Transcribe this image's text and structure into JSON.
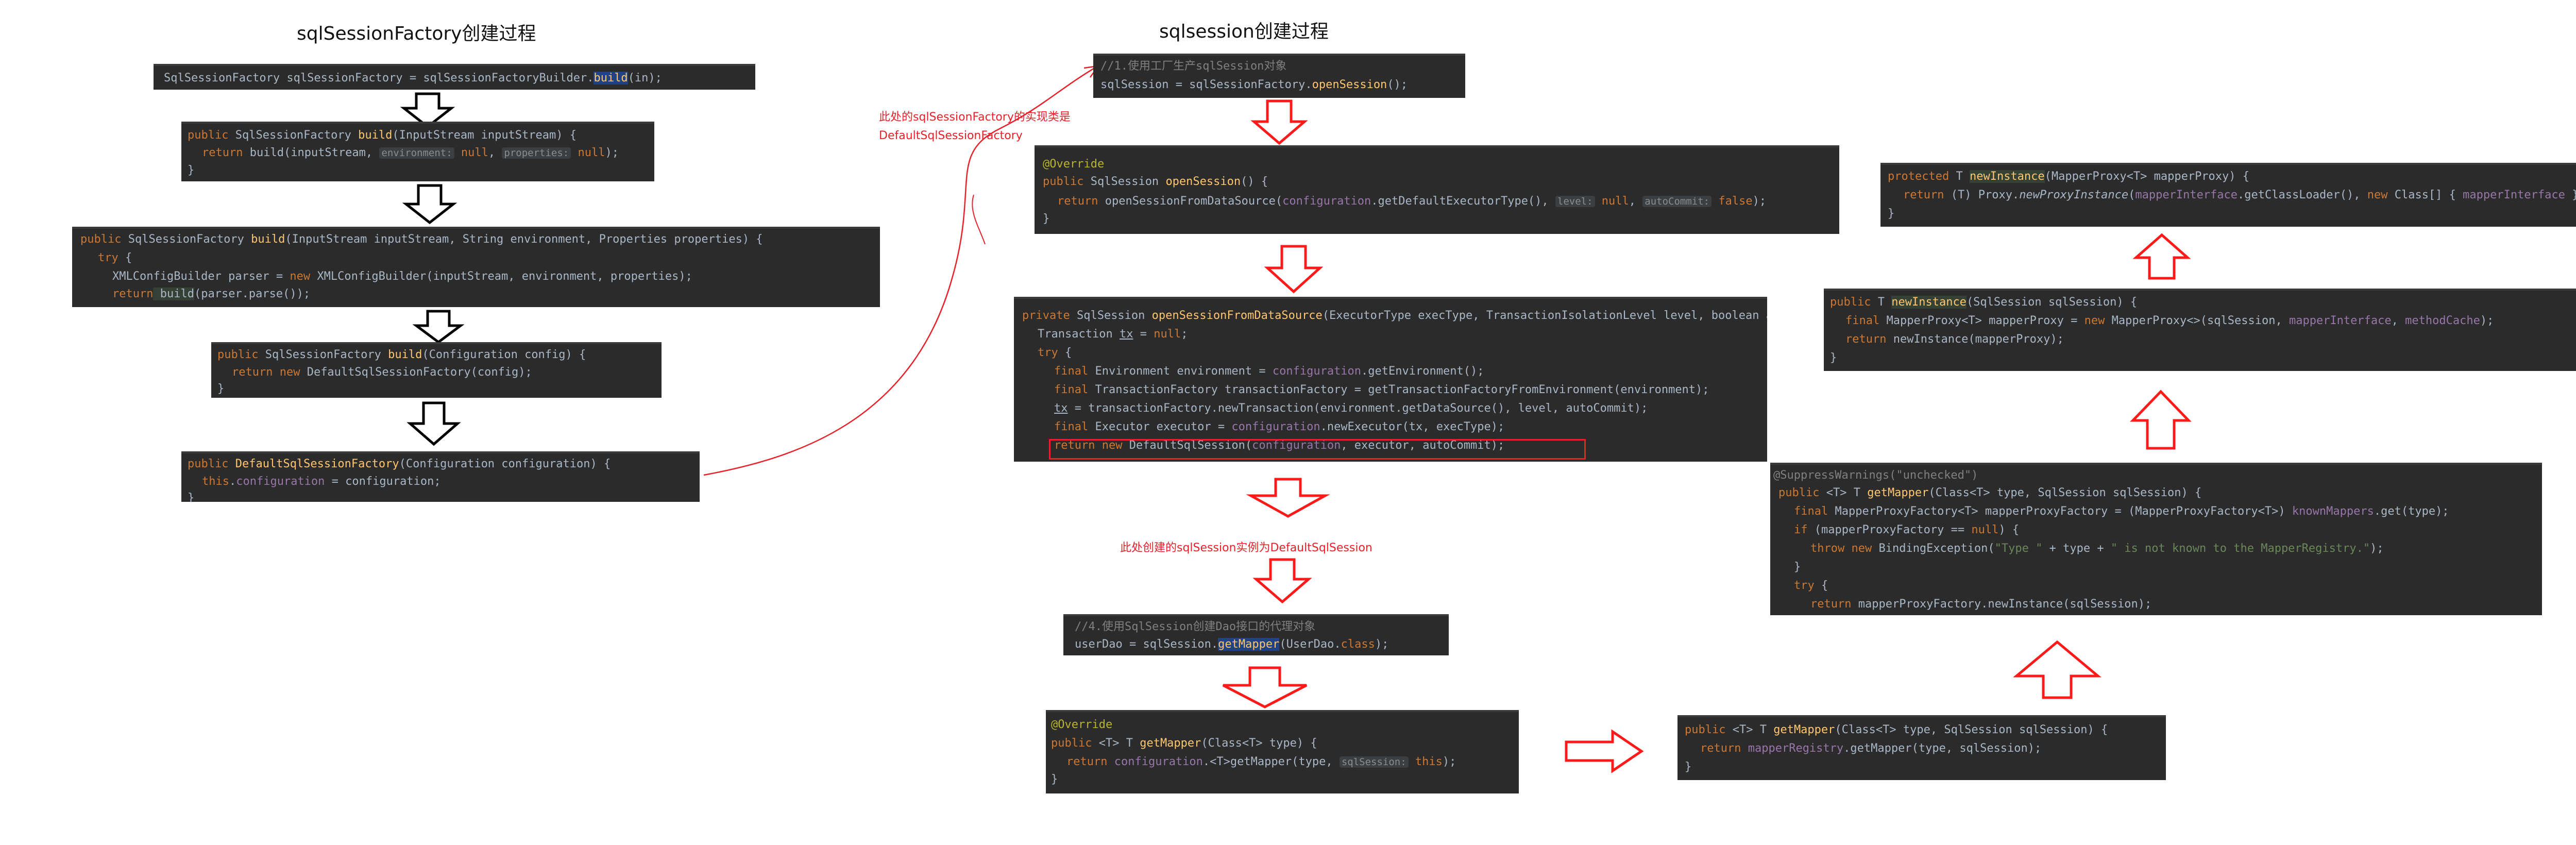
{
  "titles": {
    "factory": "sqlSessionFactory创建过程",
    "session": "sqlsession创建过程"
  },
  "notes": {
    "impl_line1": "此处的sqlSessionFactory的实现类是",
    "impl_line2": "DefaultSqlSessionFactory",
    "session_impl": "此处创建的sqlSession实例为DefaultSqlSession"
  },
  "code": {
    "b1": {
      "l1a": "SqlSessionFactory sqlSessionFactory = sqlSessionFactoryBuilder.",
      "l1b": "build",
      "l1c": "(in);"
    },
    "b2": {
      "l1_kw": "public",
      "l1_type": " SqlSessionFactory ",
      "l1_fn": "build",
      "l1_rest": "(InputStream inputStream) {",
      "l2_kw": "return",
      "l2_a": " build(inputStream, ",
      "l2_h1": "environment:",
      "l2_v1": " null",
      "l2_b": ", ",
      "l2_h2": "properties:",
      "l2_v2": " null",
      "l2_c": ");",
      "l3": "}"
    },
    "b3": {
      "l1_kw": "public",
      "l1_type": " SqlSessionFactory ",
      "l1_fn": "build",
      "l1_rest": "(InputStream inputStream, String environment, Properties properties) {",
      "l2_kw": "try",
      "l2_rest": " {",
      "l3_a": "XMLConfigBuilder parser = ",
      "l3_kw": "new",
      "l3_b": " XMLConfigBuilder(inputStream, environment, properties);",
      "l4_kw": "return",
      "l4_hl": " build",
      "l4_rest": "(parser.parse());"
    },
    "b4": {
      "l1_kw": "public",
      "l1_type": " SqlSessionFactory ",
      "l1_fn": "build",
      "l1_rest": "(Configuration config) {",
      "l2_kw": "return new",
      "l2_rest": " DefaultSqlSessionFactory(config);",
      "l3": "}"
    },
    "b5": {
      "l1_kw": "public",
      "l1_fn": " DefaultSqlSessionFactory",
      "l1_rest": "(Configuration configuration) {",
      "l2_kw": "this",
      "l2_dot": ".",
      "l2_fld": "configuration",
      "l2_rest": " = configuration;",
      "l3": "}"
    },
    "s1": {
      "l1": "//1.使用工厂生产sqlSession对象",
      "l2a": "sqlSession = sqlSessionFactory.",
      "l2b": "openSession",
      "l2c": "();"
    },
    "s2": {
      "l1": "@Override",
      "l2_kw": "public",
      "l2_type": " SqlSession ",
      "l2_fn": "openSession",
      "l2_rest": "() {",
      "l3_kw": "return",
      "l3_a": " openSessionFromDataSource(",
      "l3_fld": "configuration",
      "l3_b": ".getDefaultExecutorType(), ",
      "l3_h1": "level:",
      "l3_v1": " null",
      "l3_c": ", ",
      "l3_h2": "autoCommit:",
      "l3_v2": " false",
      "l3_d": ");",
      "l4": "}"
    },
    "s3": {
      "l1_kw": "private",
      "l1_type": " SqlSession ",
      "l1_fn": "openSessionFromDataSource",
      "l1_rest": "(ExecutorType execType, TransactionIsolationLevel level, boolean autoCommit) {",
      "l2_a": "Transaction ",
      "l2_u": "tx",
      "l2_b": " = ",
      "l2_kw": "null",
      "l2_c": ";",
      "l3_kw": "try",
      "l3_rest": " {",
      "l4_kw": "final",
      "l4_a": " Environment environment = ",
      "l4_fld": "configuration",
      "l4_b": ".getEnvironment();",
      "l5_kw": "final",
      "l5_a": " TransactionFactory transactionFactory = getTransactionFactoryFromEnvironment(environment);",
      "l6_u": "tx",
      "l6_rest": " = transactionFactory.newTransaction(environment.getDataSource(), level, autoCommit);",
      "l7_kw": "final",
      "l7_a": " Executor executor = ",
      "l7_fld": "configuration",
      "l7_b": ".newExecutor(tx, execType);",
      "l8_kw": "return new",
      "l8_a": " DefaultSqlSession(",
      "l8_fld": "configuration",
      "l8_b": ", executor, autoCommit);"
    },
    "s4": {
      "l1": "//4.使用SqlSession创建Dao接口的代理对象",
      "l2a": "userDao = sqlSession.",
      "l2b": "getMapper",
      "l2c": "(UserDao.",
      "l2kw": "class",
      "l2d": ");"
    },
    "s5": {
      "l1": "@Override",
      "l2_kw": "public",
      "l2_a": " <T> T ",
      "l2_fn": "getMapper",
      "l2_rest": "(Class<T> type) {",
      "l3_kw": "return",
      "l3_fld": " configuration",
      "l3_a": ".<T>getMapper(type, ",
      "l3_h": "sqlSession:",
      "l3_kw2": " this",
      "l3_b": ");",
      "l4": "}"
    },
    "m1": {
      "l1_kw": "public",
      "l1_a": " <T> T ",
      "l1_fn": "getMapper",
      "l1_rest": "(Class<T> type, SqlSession sqlSession) {",
      "l2_kw": "return",
      "l2_fld": " mapperRegistry",
      "l2_rest": ".getMapper(type, sqlSession);",
      "l3": "}"
    },
    "m2": {
      "l1": "@SuppressWarnings(\"unchecked\")",
      "l2_kw": "public",
      "l2_a": " <T> T ",
      "l2_fn": "getMapper",
      "l2_rest": "(Class<T> type, SqlSession sqlSession) {",
      "l3_kw": "final",
      "l3_a": " MapperProxyFactory<T> mapperProxyFactory = (MapperProxyFactory<T>) ",
      "l3_fld": "knownMappers",
      "l3_b": ".get(type);",
      "l4_kw": "if",
      "l4_a": " (mapperProxyFactory == ",
      "l4_kw2": "null",
      "l4_b": ") {",
      "l5_kw": "throw new",
      "l5_a": " BindingException(",
      "l5_s1": "\"Type \"",
      "l5_b": " + type + ",
      "l5_s2": "\" is not known to the MapperRegistry.\"",
      "l5_c": ");",
      "l6": "}",
      "l7_kw": "try",
      "l7_rest": " {",
      "l8_kw": "return",
      "l8_rest": " mapperProxyFactory.newInstance(sqlSession);"
    },
    "m3": {
      "l1_kw": "public",
      "l1_a": " T ",
      "l1_fn": "newInstance",
      "l1_rest": "(SqlSession sqlSession) {",
      "l2_kw": "final",
      "l2_a": " MapperProxy<T> mapperProxy = ",
      "l2_kw2": "new",
      "l2_b": " MapperProxy<>(sqlSession, ",
      "l2_f1": "mapperInterface",
      "l2_c": ", ",
      "l2_f2": "methodCache",
      "l2_d": ");",
      "l3_kw": "return",
      "l3_rest": " newInstance(mapperProxy);",
      "l4": "}"
    },
    "m4": {
      "l1_kw": "protected",
      "l1_a": " T ",
      "l1_fn": "newInstance",
      "l1_rest": "(MapperProxy<T> mapperProxy) {",
      "l2_kw": "return",
      "l2_a": " (T) Proxy.",
      "l2_i": "newProxyInstance",
      "l2_b": "(",
      "l2_f1": "mapperInterface",
      "l2_c": ".getClassLoader(), ",
      "l2_kw2": "new",
      "l2_d": " Class[] { ",
      "l2_f2": "mapperInterface",
      "l2_e": " }, mapperProxy);",
      "l3": "}"
    }
  }
}
